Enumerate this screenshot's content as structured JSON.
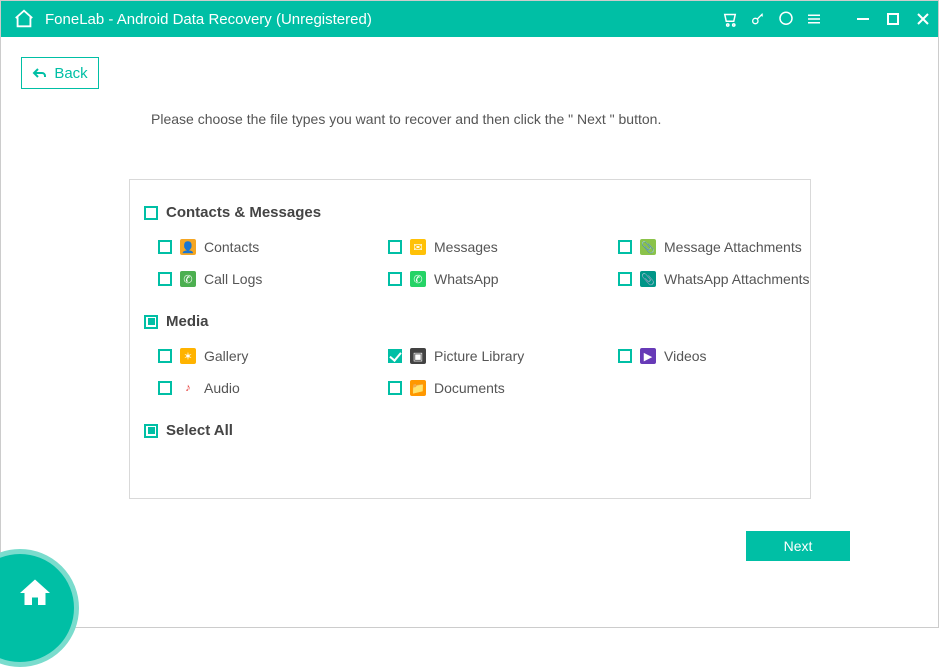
{
  "title": "FoneLab - Android Data Recovery (Unregistered)",
  "back_label": "Back",
  "instruction": "Please choose the file types you want to recover and then click the \" Next \" button.",
  "sections": {
    "contacts": {
      "heading": "Contacts & Messages",
      "state": "unchecked",
      "items": [
        {
          "label": "Contacts",
          "state": "unchecked",
          "icon_bg": "#f5a623",
          "icon_glyph": "👤"
        },
        {
          "label": "Messages",
          "state": "unchecked",
          "icon_bg": "#ffc107",
          "icon_glyph": "✉"
        },
        {
          "label": "Message Attachments",
          "state": "unchecked",
          "icon_bg": "#8bc34a",
          "icon_glyph": "📎"
        },
        {
          "label": "Call Logs",
          "state": "unchecked",
          "icon_bg": "#4caf50",
          "icon_glyph": "✆"
        },
        {
          "label": "WhatsApp",
          "state": "unchecked",
          "icon_bg": "#25d366",
          "icon_glyph": "✆"
        },
        {
          "label": "WhatsApp Attachments",
          "state": "unchecked",
          "icon_bg": "#009688",
          "icon_glyph": "📎"
        }
      ]
    },
    "media": {
      "heading": "Media",
      "state": "indeterminate",
      "items": [
        {
          "label": "Gallery",
          "state": "unchecked",
          "icon_bg": "#ffb300",
          "icon_glyph": "✶"
        },
        {
          "label": "Picture Library",
          "state": "checked",
          "icon_bg": "#424242",
          "icon_glyph": "▣"
        },
        {
          "label": "Videos",
          "state": "unchecked",
          "icon_bg": "#673ab7",
          "icon_glyph": "▶"
        },
        {
          "label": "Audio",
          "state": "unchecked",
          "icon_bg": "#ffffff",
          "icon_fg": "#e53935",
          "icon_glyph": "♪"
        },
        {
          "label": "Documents",
          "state": "unchecked",
          "icon_bg": "#ff9800",
          "icon_glyph": "📁"
        }
      ]
    },
    "select_all": {
      "label": "Select All",
      "state": "indeterminate"
    }
  },
  "next_label": "Next",
  "colors": {
    "accent": "#00bfa5"
  }
}
